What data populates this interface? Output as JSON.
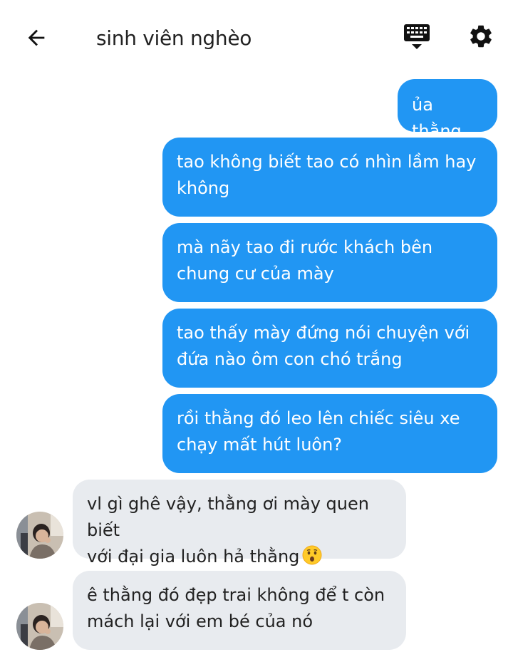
{
  "header": {
    "title": "sinh viên nghèo",
    "back_icon": "arrow-left-icon",
    "keyboard_icon": "keyboard-icon",
    "settings_icon": "gear-icon"
  },
  "messages": {
    "sent": [
      "ủa thằng",
      "tao không biết tao có nhìn lầm hay không",
      "mà nãy tao đi rước khách bên chung cư của mày",
      "tao thấy mày đứng nói chuyện với đứa nào ôm con chó trắng",
      "rồi thằng đó leo lên chiếc siêu xe chạy mất hút luôn?"
    ],
    "received": [
      {
        "line1": "vl gì ghê vậy, thằng ơi mày quen biết",
        "line2": "với đại gia luôn hả thằng",
        "emoji": "hushed-face-emoji"
      },
      {
        "line1": "ê thằng đó đẹp trai không để t còn",
        "line2": "mách lại với em bé của nó"
      }
    ]
  },
  "colors": {
    "sent_bubble": "#2196f3",
    "received_bubble": "#e8ebef",
    "text": "#222222"
  }
}
